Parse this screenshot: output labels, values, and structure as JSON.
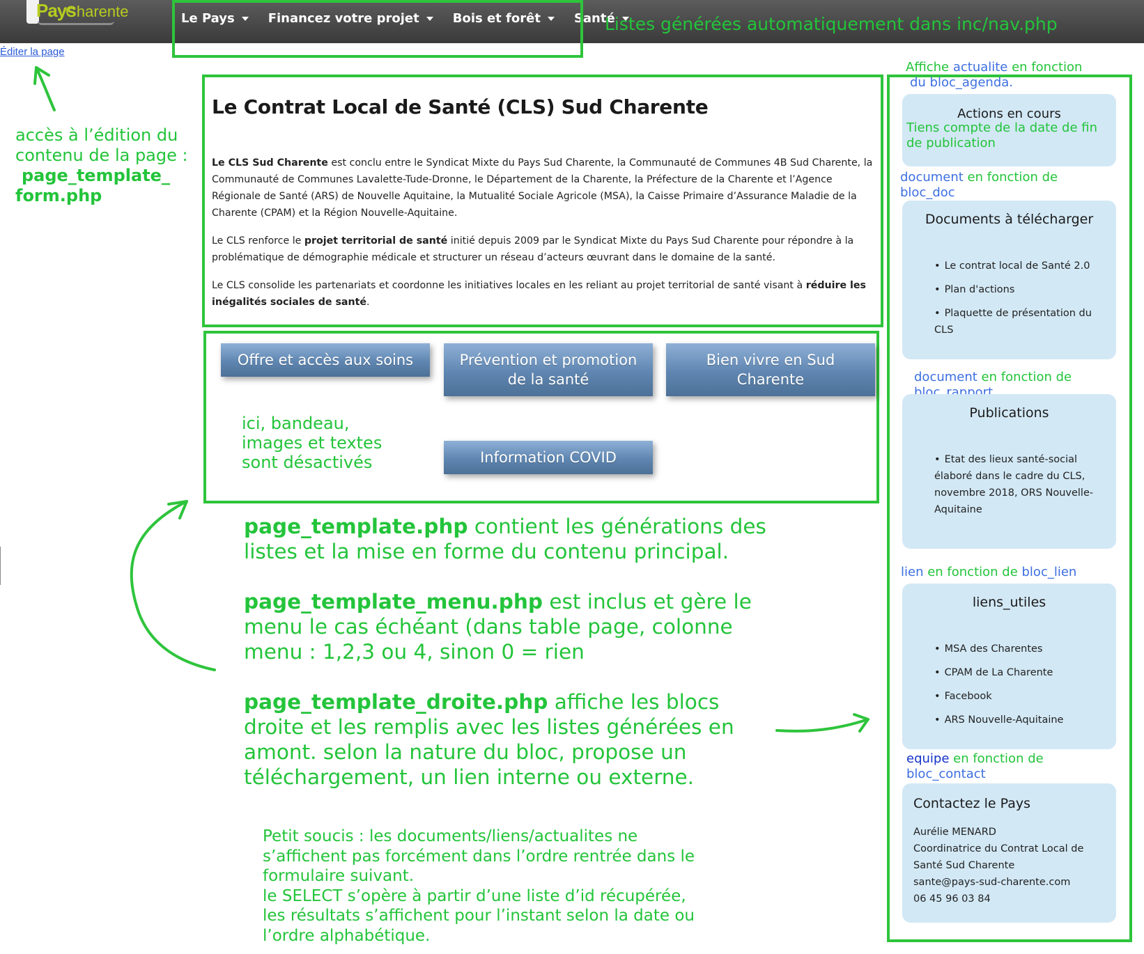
{
  "logo": {
    "text_pays": "Pays",
    "text_charente": "Charente"
  },
  "nav": {
    "items": [
      {
        "label": "Le Pays"
      },
      {
        "label": "Financez votre projet"
      },
      {
        "label": "Bois et forêt"
      },
      {
        "label": "Santé"
      }
    ],
    "annotation": "Listes générées automatiquement dans inc/nav.php"
  },
  "edit_link": "Éditer la page",
  "annotations": {
    "edit": [
      "accès à l’édition du",
      "contenu de la page :"
    ],
    "edit_file": [
      "page_template_",
      "form.php"
    ],
    "buttons_area": [
      "ici, bandeau,",
      "images et textes",
      "sont désactivés"
    ],
    "template_main": {
      "file": "page_template.php",
      "text1": " contient les générations des",
      "text2": "listes et la mise en forme du contenu principal."
    },
    "template_menu": {
      "file": "page_template_menu.php",
      "text1": " est inclus et gère le",
      "text2": "menu le cas échéant (dans table page, colonne",
      "text3": "menu : 1,2,3 ou 4, sinon 0 = rien"
    },
    "template_droite": {
      "file": "page_template_droite.php",
      "text1": " affiche les blocs",
      "text2": "droite et les remplis avec les listes générées en",
      "text3": "amont. selon la nature du bloc, propose un",
      "text4": "téléchargement, un lien interne ou externe."
    },
    "issue": [
      "Petit soucis : les documents/liens/actualites ne",
      "s’affichent pas forcément dans l’ordre rentrée dans le",
      "formulaire suivant.",
      "le SELECT s’opère à partir d’une liste d’id récupérée,",
      "les résultats s’affichent pour l’instant selon la date ou",
      "l’ordre alphabétique."
    ],
    "agenda": {
      "a": "Affiche ",
      "b": "actualite",
      "c": " en fonction",
      "d": "du bloc_agenda."
    },
    "agenda_note": [
      "Tiens compte de la date de fin",
      "de publication"
    ],
    "doc": {
      "a": "document",
      "b": " en fonction de",
      "c": "bloc_doc"
    },
    "rapport": {
      "a": "document",
      "b": " en fonction de",
      "c": "bloc_rapport"
    },
    "lien": {
      "a": "lien",
      "b": " en fonction de ",
      "c": "bloc_lien"
    },
    "contact": {
      "a": "equipe",
      "b": " en fonction de",
      "c": "bloc_contact"
    }
  },
  "article": {
    "title": "Le Contrat Local de Santé (CLS) Sud Charente",
    "p1_bold": "Le CLS Sud Charente",
    "p1_text": " est conclu entre le Syndicat Mixte du Pays Sud Charente, la Communauté de Communes 4B Sud Charente, la Communauté de Communes Lavalette-Tude-Dronne, le Département de la Charente, la Préfecture de la Charente et l’Agence Régionale de Santé (ARS) de Nouvelle Aquitaine, la Mutualité Sociale Agricole (MSA), la Caisse Primaire d’Assurance Maladie de la Charente (CPAM) et la Région Nouvelle-Aquitaine.",
    "p2_a": "Le CLS renforce le ",
    "p2_bold": "projet territorial de santé",
    "p2_b": " initié depuis 2009 par le Syndicat Mixte du Pays Sud Charente pour répondre à la problématique de démographie médicale et structurer un réseau d’acteurs œuvrant dans le domaine de la santé.",
    "p3_a": "Le CLS consolide les partenariats et coordonne les initiatives locales en les reliant au projet territorial de santé visant à ",
    "p3_bold": "réduire les inégalités sociales de santé",
    "p3_b": "."
  },
  "buttons": {
    "offre": "Offre et accès aux soins",
    "prevention": "Prévention et promotion de la santé",
    "bien_vivre": "Bien vivre en Sud Charente",
    "covid": "Information COVID"
  },
  "sidebar": {
    "actions": {
      "title": "Actions en cours"
    },
    "documents": {
      "title": "Documents à télécharger",
      "items": [
        "Le contrat local de Santé 2.0",
        "Plan d'actions",
        "Plaquette de présentation du CLS"
      ]
    },
    "publications": {
      "title": "Publications",
      "items": [
        "Etat des lieux santé-social élaboré dans le cadre du CLS, novembre 2018, ORS Nouvelle-Aquitaine"
      ]
    },
    "liens": {
      "title": "liens_utiles",
      "items": [
        "MSA des Charentes",
        "CPAM de La Charente",
        "Facebook",
        "ARS Nouvelle-Aquitaine"
      ]
    },
    "contact": {
      "title": "Contactez le Pays",
      "name": "Aurélie MENARD",
      "role": "Coordinatrice du Contrat Local de Santé Sud Charente",
      "email": "sante@pays-sud-charente.com",
      "phone": "06 45 96 03 84"
    }
  },
  "colors": {
    "annotation_green": "#23c43a",
    "annotation_blue": "#3d6fe0",
    "button_blue": "#5f86b1",
    "card_bg": "#d2e8f5",
    "navbar": "#4a4a4a"
  }
}
